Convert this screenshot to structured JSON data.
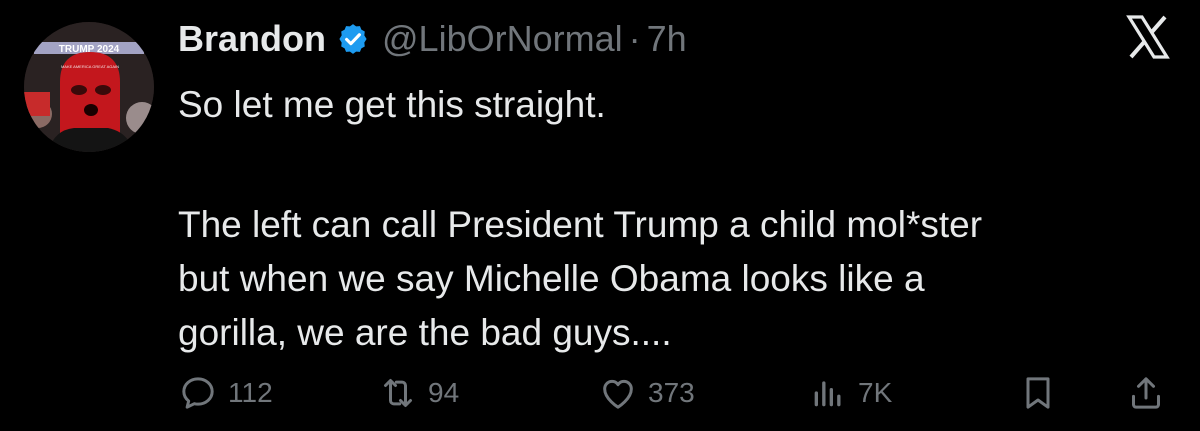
{
  "author": {
    "display_name": "Brandon",
    "handle": "@LibOrNormal",
    "separator": "·",
    "time": "7h",
    "verified": true,
    "verified_color": "#1d9bf0",
    "avatar_banner_text": "TRUMP 2024",
    "avatar_hat_text": "MAKE AMERICA GREAT AGAIN"
  },
  "brand": {
    "logo": "x-logo-icon"
  },
  "tweet": {
    "line1": "So let me get this straight.",
    "line2": "The left can call President Trump a child mol*ster",
    "line3": "but when we say Michelle Obama looks like a",
    "line4": "gorilla,  we are the bad guys...."
  },
  "actions": {
    "replies": "112",
    "reposts": "94",
    "likes": "373",
    "views": "7K"
  },
  "colors": {
    "background": "#000000",
    "text": "#e7e9ea",
    "muted": "#71767b"
  }
}
